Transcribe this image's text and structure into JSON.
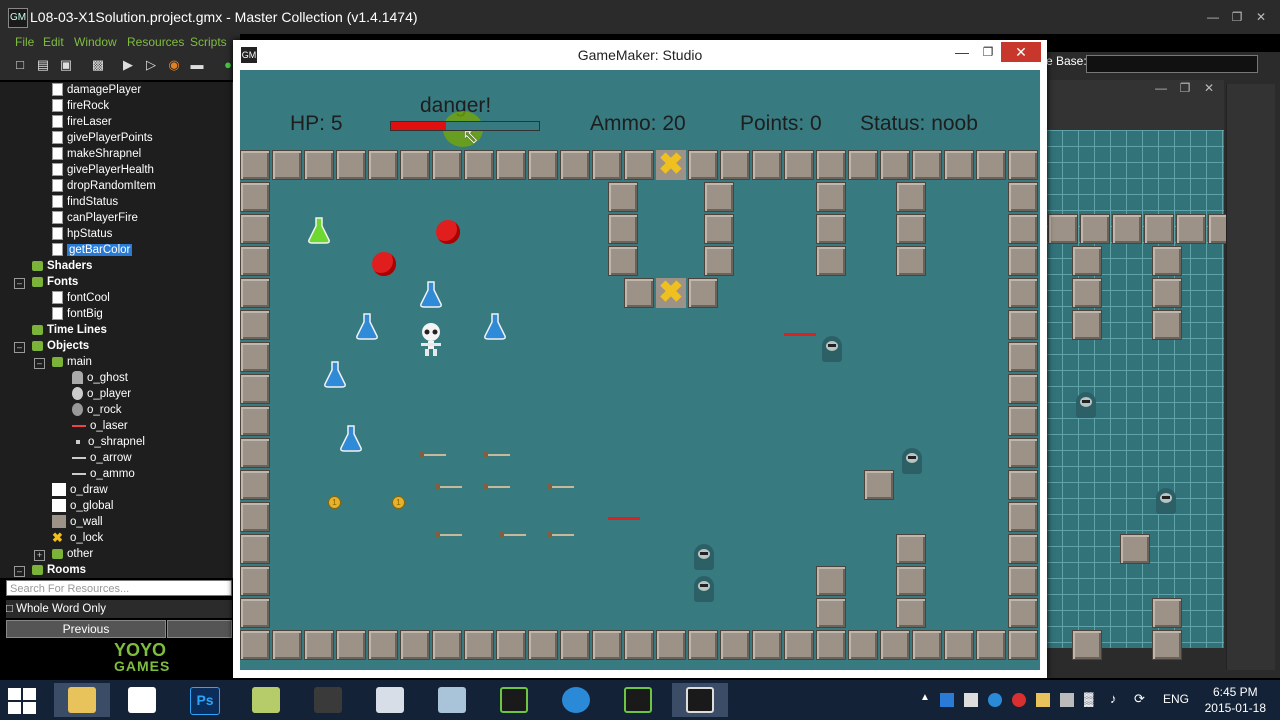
{
  "ide": {
    "title": "L08-03-X1Solution.project.gmx  -  Master Collection (v1.4.1474)",
    "menu": [
      "File",
      "Edit",
      "Window",
      "Resources",
      "Scripts"
    ],
    "right_label": "e Base:"
  },
  "tree": {
    "scripts": [
      "damagePlayer",
      "fireRock",
      "fireLaser",
      "givePlayerPoints",
      "makeShrapnel",
      "givePlayerHealth",
      "dropRandomItem",
      "findStatus",
      "canPlayerFire",
      "hpStatus",
      "getBarColor"
    ],
    "selected_script": "getBarColor",
    "groups": {
      "shaders": "Shaders",
      "fonts": "Fonts",
      "timelines": "Time Lines",
      "objects": "Objects",
      "rooms": "Rooms"
    },
    "fonts": [
      "fontCool",
      "fontBig"
    ],
    "main_folder": "main",
    "main_objects": [
      "o_ghost",
      "o_player",
      "o_rock",
      "o_laser",
      "o_shrapnel",
      "o_arrow",
      "o_ammo"
    ],
    "objects": [
      "o_draw",
      "o_global",
      "o_wall",
      "o_lock"
    ],
    "other_folder": "other",
    "search_placeholder": "Search For Resources...",
    "whole_word": "Whole Word Only",
    "previous": "Previous",
    "brand": [
      "YOYO",
      "GAMES"
    ]
  },
  "game": {
    "window_title": "GameMaker: Studio",
    "hp": "HP: 5",
    "danger": "danger!",
    "hp_fraction": 0.37,
    "ammo": "Ammo: 20",
    "points": "Points: 0",
    "status": "Status: noob",
    "colors": {
      "floor": "#377a80",
      "bar": "#e01010",
      "wall": "#9c9287"
    }
  },
  "taskbar": {
    "lang": "ENG",
    "time": "6:45 PM",
    "date": "2015-01-18",
    "ps_label": "Ps"
  }
}
